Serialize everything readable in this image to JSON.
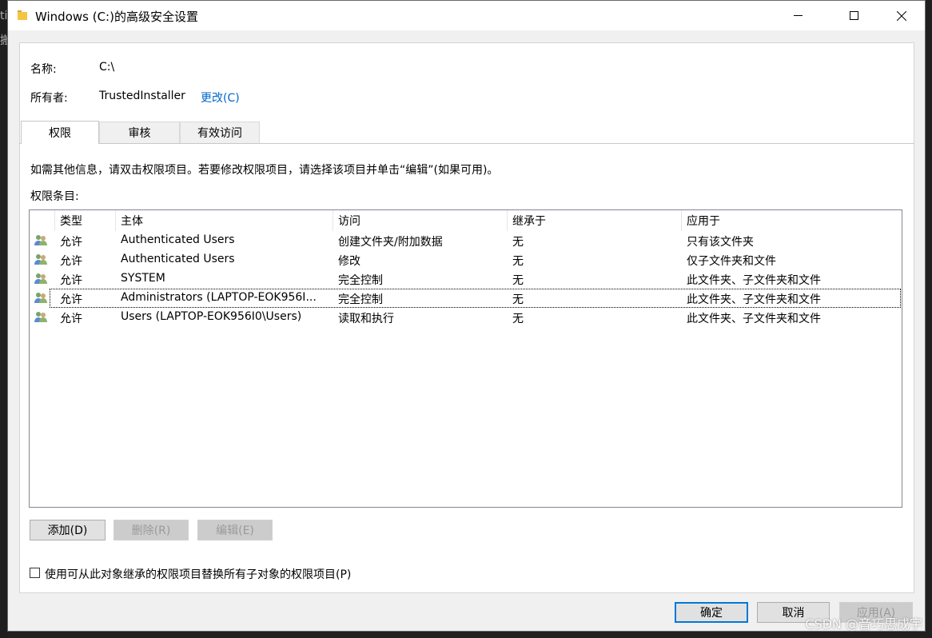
{
  "window": {
    "title": "Windows (C:)的高级安全设置",
    "controls": {
      "minimize": "minimize",
      "maximize": "maximize",
      "close": "close"
    }
  },
  "info": {
    "name_label": "名称:",
    "name_value": "C:\\",
    "owner_label": "所有者:",
    "owner_value": "TrustedInstaller",
    "change_link": "更改(C)"
  },
  "tabs": [
    {
      "label": "权限",
      "active": true
    },
    {
      "label": "审核",
      "active": false
    },
    {
      "label": "有效访问",
      "active": false
    }
  ],
  "hint": "如需其他信息，请双击权限项目。若要修改权限项目，请选择该项目并单击“编辑”(如果可用)。",
  "entries_label": "权限条目:",
  "columns": [
    "类型",
    "主体",
    "访问",
    "继承于",
    "应用于"
  ],
  "rows": [
    {
      "type": "允许",
      "principal": "Authenticated Users",
      "access": "创建文件夹/附加数据",
      "inherited": "无",
      "applies": "只有该文件夹"
    },
    {
      "type": "允许",
      "principal": "Authenticated Users",
      "access": "修改",
      "inherited": "无",
      "applies": "仅子文件夹和文件"
    },
    {
      "type": "允许",
      "principal": "SYSTEM",
      "access": "完全控制",
      "inherited": "无",
      "applies": "此文件夹、子文件夹和文件"
    },
    {
      "type": "允许",
      "principal": "Administrators (LAPTOP-EOK956I...",
      "access": "完全控制",
      "inherited": "无",
      "applies": "此文件夹、子文件夹和文件"
    },
    {
      "type": "允许",
      "principal": "Users (LAPTOP-EOK956I0\\Users)",
      "access": "读取和执行",
      "inherited": "无",
      "applies": "此文件夹、子文件夹和文件"
    }
  ],
  "actions": {
    "add": "添加(D)",
    "remove": "删除(R)",
    "edit": "编辑(E)"
  },
  "replace_checkbox": "使用可从此对象继承的权限项目替换所有子对象的权限项目(P)",
  "footer": {
    "ok": "确定",
    "cancel": "取消",
    "apply": "应用(A)"
  },
  "watermark": "CSDN @音巧思成宇",
  "colors": {
    "link": "#0066cc",
    "default_button_border": "#0078d7"
  }
}
